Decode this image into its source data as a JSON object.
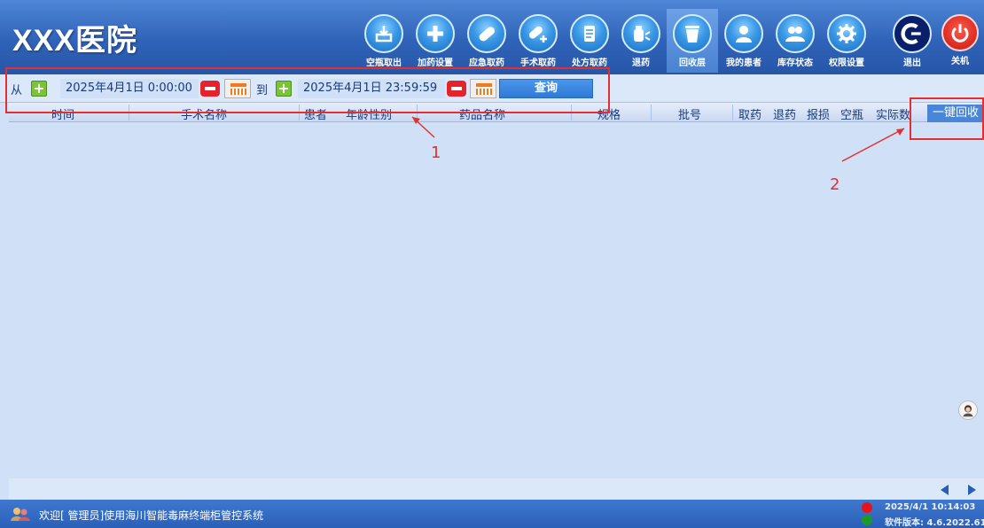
{
  "header": {
    "hospital_name": "XXX医院",
    "nav": [
      {
        "label": "空瓶取出",
        "icon": "tray-out-icon"
      },
      {
        "label": "加药设置",
        "icon": "plus-icon"
      },
      {
        "label": "应急取药",
        "icon": "pill-icon"
      },
      {
        "label": "手术取药",
        "icon": "pill-add-icon"
      },
      {
        "label": "处方取药",
        "icon": "prescription-icon"
      },
      {
        "label": "退药",
        "icon": "bottle-icon"
      },
      {
        "label": "回收层",
        "icon": "trash-icon"
      },
      {
        "label": "我的患者",
        "icon": "user-icon"
      },
      {
        "label": "库存状态",
        "icon": "users-icon"
      },
      {
        "label": "权限设置",
        "icon": "gear-icon"
      }
    ],
    "active_nav": "回收层",
    "exit_label": "退出",
    "power_label": "关机"
  },
  "query": {
    "from_label": "从",
    "to_label": "到",
    "start": "2025年4月1日 0:00:00",
    "end": "2025年4月1日 23:59:59",
    "query_button": "查询"
  },
  "table": {
    "columns": [
      "时间",
      "手术名称",
      "患者",
      "年龄性别",
      "药品名称",
      "规格",
      "批号",
      "取药",
      "退药",
      "报损",
      "空瓶",
      "实际数"
    ],
    "recycle_button": "一键回收"
  },
  "status": {
    "welcome": "欢迎[ 管理员]使用海川智能毒麻终端柜管控系统",
    "datetime": "2025/4/1 10:14:03",
    "version": "软件版本: 4.6.2022.613",
    "indicator_colors": [
      "#e6141b",
      "#1a9a2a"
    ]
  },
  "annotations": {
    "label_1": "1",
    "label_2": "2",
    "color": "#e23030"
  }
}
